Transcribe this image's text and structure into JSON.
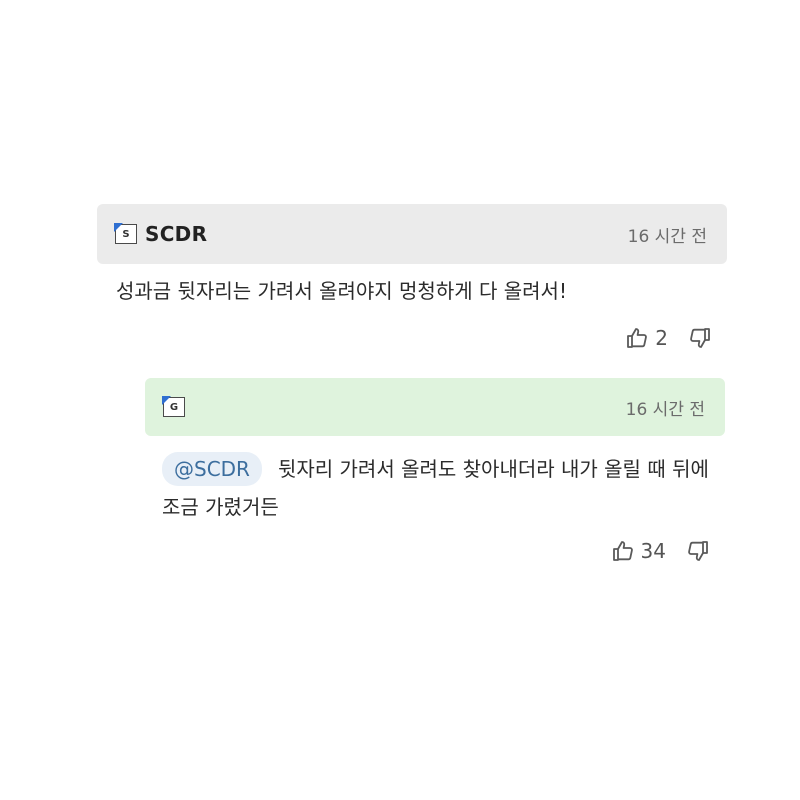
{
  "comments": [
    {
      "badge": "S",
      "username": "SCDR",
      "timestamp": "16 시간 전",
      "text": "성과금 뒷자리는 가려서 올려야지 멍청하게 다 올려서!",
      "likes": "2",
      "header_color": "#ebebeb"
    },
    {
      "badge": "G",
      "username": "",
      "timestamp": "16 시간 전",
      "mention": "@SCDR",
      "text": "뒷자리 가려서 올려도 찾아내더라 내가 올릴 때 뒤에 조금 가렸거든",
      "likes": "34",
      "header_color": "#dff3dd"
    }
  ],
  "icons": {
    "like": "thumbs-up-icon",
    "dislike": "thumbs-down-icon"
  }
}
